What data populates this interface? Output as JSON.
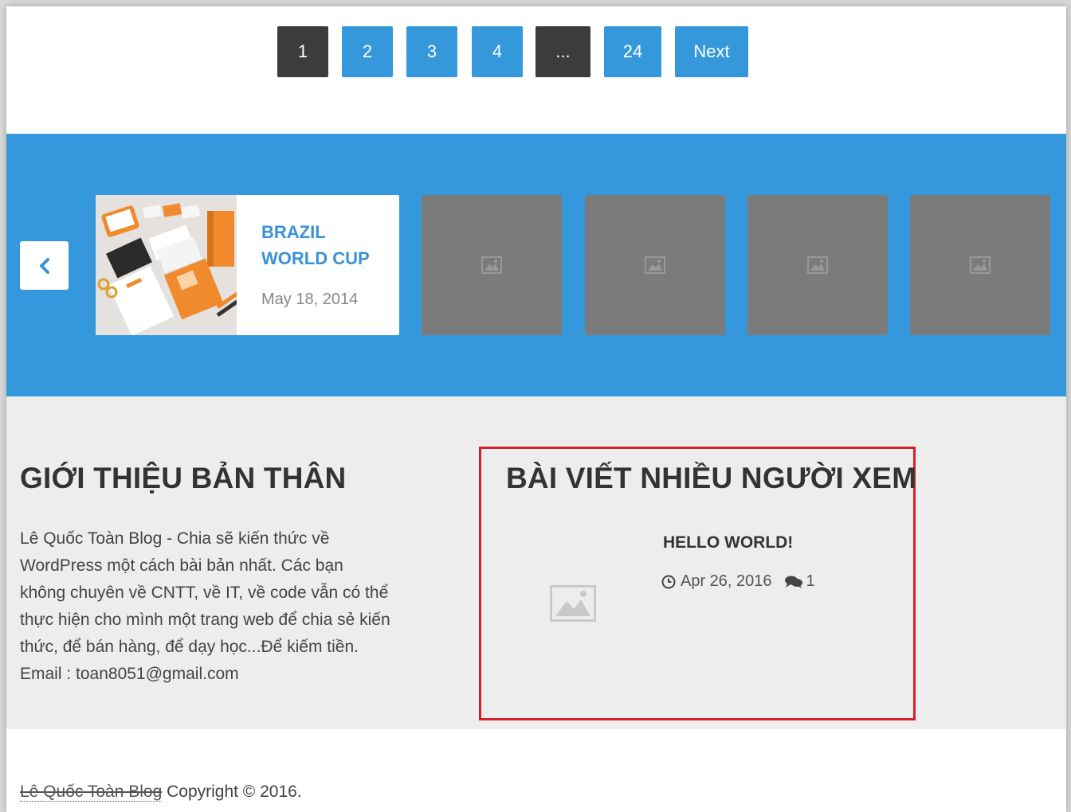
{
  "pagination": {
    "pages": [
      "1",
      "2",
      "3",
      "4",
      "...",
      "24"
    ],
    "next_label": "Next",
    "current": "1"
  },
  "slider": {
    "featured": {
      "title": "BRAZIL WORLD CUP",
      "date": "May 18, 2014"
    },
    "placeholder_count": 4,
    "icons": {
      "prev": "chevron-left-icon",
      "placeholder": "image-placeholder-icon"
    }
  },
  "about": {
    "title": "GIỚI THIỆU BẢN THÂN",
    "lines": [
      "Lê Quốc Toàn Blog - Chia sẽ kiến thức về",
      "WordPress một cách bài bản nhất. Các bạn",
      "không chuyên về CNTT, về IT, về code vẫn có thể",
      "thực hiện cho mình một trang web để chia sẻ kiến",
      "thức, để bán hàng, để dạy học...Để kiếm tiền.",
      "Email : toan8051@gmail.com"
    ]
  },
  "popular": {
    "title": "BÀI VIẾT NHIỀU NGƯỜI XEM",
    "post": {
      "title": "HELLO WORLD!",
      "date": "Apr 26, 2016",
      "comments": "1"
    }
  },
  "footer": {
    "site_link": "Lê Quốc Toàn Blog",
    "copyright": "Copyright © 2016."
  },
  "colors": {
    "accent_blue": "#3498db",
    "band_blue": "#3698dc",
    "dark_button": "#3c3c3c",
    "highlight_red": "#d91f2a",
    "title_blue": "#3a92d6"
  }
}
